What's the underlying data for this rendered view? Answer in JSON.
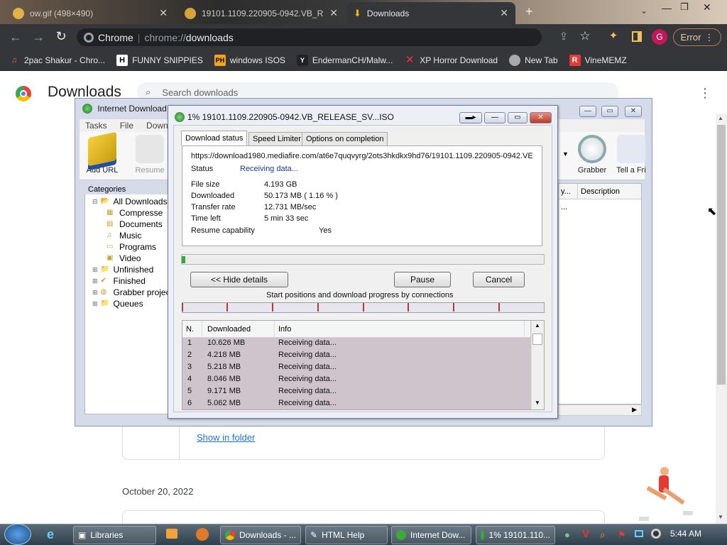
{
  "browser": {
    "tabs": [
      {
        "label": "ow.gif (498×490)"
      },
      {
        "label": "19101.1109.220905-0942.VB_RE"
      },
      {
        "label": "Downloads"
      }
    ],
    "new_tab": "+",
    "omnibox": {
      "origin": "Chrome",
      "scheme": "chrome://",
      "path": "downloads"
    },
    "error_label": "Error",
    "profile_initial": "G",
    "bookmarks": [
      {
        "label": "2pac Shakur - Chro...",
        "icon": "music-icon"
      },
      {
        "label": "FUNNY SNIPPIES",
        "icon": "H"
      },
      {
        "label": "windows ISOS",
        "icon": "PH"
      },
      {
        "label": "EndermanCH/Malw...",
        "icon": "YP"
      },
      {
        "label": "XP Horror Download",
        "icon": "X"
      },
      {
        "label": "New Tab",
        "icon": "globe-icon"
      },
      {
        "label": "VineMEMZ",
        "icon": "R"
      }
    ]
  },
  "downloads_page": {
    "title": "Downloads",
    "search_placeholder": "Search downloads",
    "show_in_folder": "Show in folder",
    "date_header": "October 20, 2022"
  },
  "idm": {
    "title": "Internet Download",
    "menu": [
      "Tasks",
      "File",
      "Downlo"
    ],
    "tools": {
      "add_url": "Add URL",
      "resume": "Resume",
      "grabber": "Grabber",
      "tell": "Tell a Fri"
    },
    "categories_label": "Categories",
    "categories": [
      {
        "label": "All Downloads",
        "level": 0
      },
      {
        "label": "Compresse",
        "level": 1
      },
      {
        "label": "Documents",
        "level": 1
      },
      {
        "label": "Music",
        "level": 1
      },
      {
        "label": "Programs",
        "level": 1
      },
      {
        "label": "Video",
        "level": 1
      },
      {
        "label": "Unfinished",
        "level": 0
      },
      {
        "label": "Finished",
        "level": 0
      },
      {
        "label": "Grabber projec",
        "level": 0
      },
      {
        "label": "Queues",
        "level": 0
      }
    ],
    "grid_header": {
      "col1": "y...",
      "col2": "Description"
    },
    "grid_cell": "..."
  },
  "dialog": {
    "title": "1% 19101.1109.220905-0942.VB_RELEASE_SV...ISO",
    "tabs": [
      "Download status",
      "Speed Limiter",
      "Options on completion"
    ],
    "url": "https://download1980.mediafire.com/at6e7quqvyrg/2ots3hkdkx9hd76/19101.1109.220905-0942.VE",
    "status_label": "Status",
    "status_value": "Receiving data...",
    "rows": [
      {
        "label": "File size",
        "value": "4.193  GB"
      },
      {
        "label": "Downloaded",
        "value": "50.173  MB  ( 1.16 % )"
      },
      {
        "label": "Transfer rate",
        "value": "12.731  MB/sec"
      },
      {
        "label": "Time left",
        "value": "5 min 33 sec"
      },
      {
        "label": "Resume capability",
        "value": "Yes"
      }
    ],
    "progress": 0.0116,
    "buttons": {
      "hide": "<< Hide details",
      "pause": "Pause",
      "cancel": "Cancel"
    },
    "connections_label": "Start positions and download progress by connections",
    "table_headers": {
      "n": "N.",
      "downloaded": "Downloaded",
      "info": "Info"
    },
    "connections": [
      {
        "n": "1",
        "downloaded": "10.626  MB",
        "info": "Receiving data..."
      },
      {
        "n": "2",
        "downloaded": "4.218  MB",
        "info": "Receiving data..."
      },
      {
        "n": "3",
        "downloaded": "5.218  MB",
        "info": "Receiving data..."
      },
      {
        "n": "4",
        "downloaded": "8.046  MB",
        "info": "Receiving data..."
      },
      {
        "n": "5",
        "downloaded": "9.171  MB",
        "info": "Receiving data..."
      },
      {
        "n": "6",
        "downloaded": "5.062  MB",
        "info": "Receiving data..."
      }
    ]
  },
  "taskbar": {
    "items": [
      {
        "label": "Libraries"
      },
      {
        "label": "Downloads - ..."
      },
      {
        "label": "HTML Help"
      },
      {
        "label": "Internet Dow..."
      },
      {
        "label": "1% 19101.110..."
      }
    ],
    "clock": "5:44 AM"
  },
  "colors": {
    "progress": "#2fae3a",
    "link": "#1a73e8",
    "segment": "#b23a3a"
  }
}
